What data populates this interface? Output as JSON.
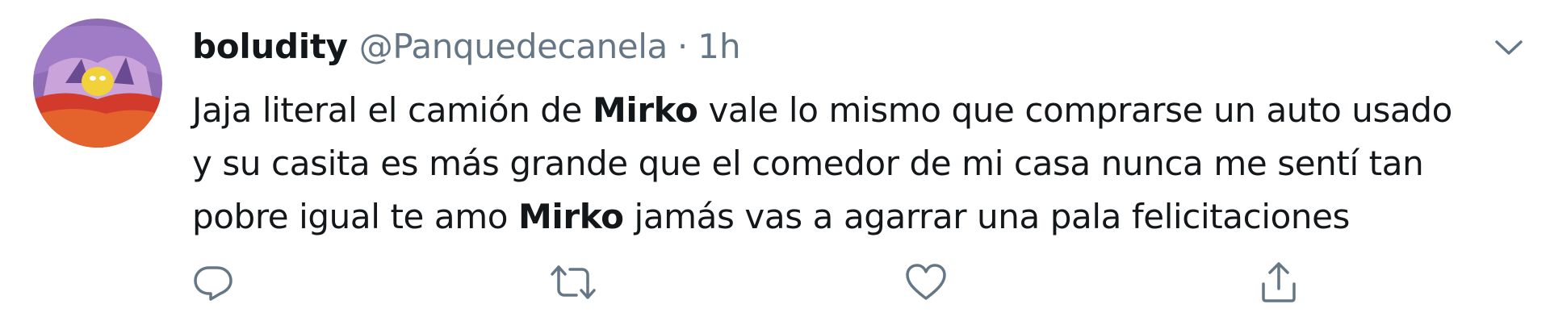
{
  "tweet": {
    "display_name": "boludity",
    "handle": "@Panquedecanela",
    "separator": "·",
    "time": "1h",
    "text": {
      "line1": {
        "before": "Jaja literal el camión de ",
        "mention": "Mirko",
        "after": " vale lo mismo que comprarse un auto usado"
      },
      "line2": "y su casita es más grande que el comedor de mi casa nunca me sentí tan",
      "line3": {
        "before": "pobre igual te amo ",
        "mention": "Mirko",
        "after": " jamás vas a agarrar una pala felicitaciones"
      }
    }
  },
  "icons": {
    "caret": "chevron-down-icon",
    "reply": "reply-icon",
    "retweet": "retweet-icon",
    "like": "heart-icon",
    "share": "share-icon"
  },
  "colors": {
    "text_primary": "#14171a",
    "text_secondary": "#657786",
    "icon_gray": "#657786",
    "avatar_purple": "#8e6db5",
    "avatar_orange": "#e4622c",
    "avatar_red": "#d23a2c",
    "avatar_yellow": "#f2d23b"
  }
}
